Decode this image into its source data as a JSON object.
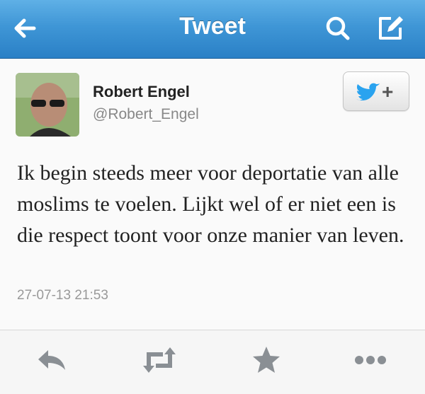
{
  "header": {
    "title": "Tweet",
    "back_icon": "back-arrow-icon",
    "search_icon": "search-icon",
    "compose_icon": "compose-icon",
    "colors": {
      "bar": "#3f96d6",
      "text": "#ffffff"
    }
  },
  "tweet": {
    "author_name": "Robert Engel",
    "author_handle": "@Robert_Engel",
    "text": "Ik begin steeds meer voor deportatie van alle moslims te voelen. Lijkt wel of er niet een is die respect toont voor onze manier van leven.",
    "timestamp": "27-07-13 21:53",
    "follow_button_icon": "twitter-bird-plus-icon",
    "follow_button_label": "+"
  },
  "actions": [
    {
      "name": "reply",
      "icon": "reply-icon"
    },
    {
      "name": "retweet",
      "icon": "retweet-icon"
    },
    {
      "name": "favorite",
      "icon": "star-icon"
    },
    {
      "name": "more",
      "icon": "more-icon"
    }
  ],
  "colors": {
    "accent": "#2aa3ef",
    "muted": "#888888",
    "action_icon": "#8a8f94"
  }
}
